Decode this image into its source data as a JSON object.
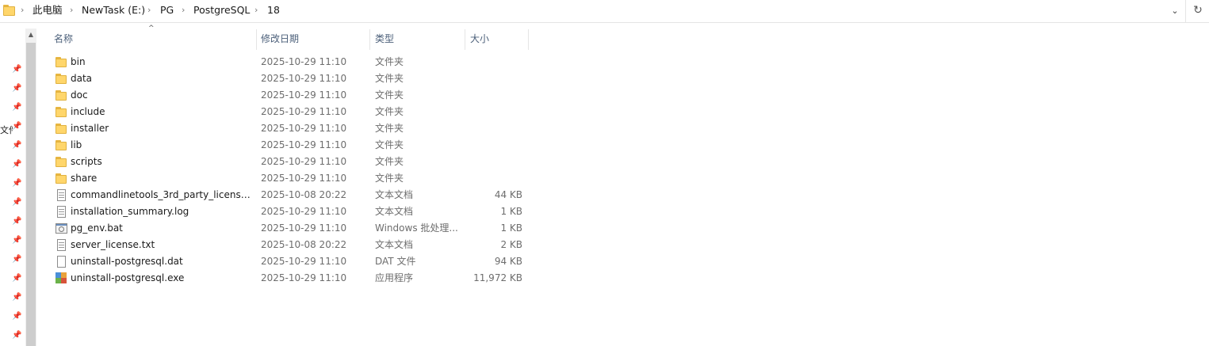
{
  "address_bar": {
    "crumbs": [
      "此电脑",
      "NewTask (E:)",
      "PG",
      "PostgreSQL",
      "18"
    ]
  },
  "nav_pane": {
    "label": "文件"
  },
  "columns": {
    "name": "名称",
    "date": "修改日期",
    "type": "类型",
    "size": "大小"
  },
  "files": [
    {
      "name": "bin",
      "date": "2025-10-29 11:10",
      "type": "文件夹",
      "size": "",
      "icon": "folder-icon"
    },
    {
      "name": "data",
      "date": "2025-10-29 11:10",
      "type": "文件夹",
      "size": "",
      "icon": "folder-icon"
    },
    {
      "name": "doc",
      "date": "2025-10-29 11:10",
      "type": "文件夹",
      "size": "",
      "icon": "folder-icon"
    },
    {
      "name": "include",
      "date": "2025-10-29 11:10",
      "type": "文件夹",
      "size": "",
      "icon": "folder-icon"
    },
    {
      "name": "installer",
      "date": "2025-10-29 11:10",
      "type": "文件夹",
      "size": "",
      "icon": "folder-icon"
    },
    {
      "name": "lib",
      "date": "2025-10-29 11:10",
      "type": "文件夹",
      "size": "",
      "icon": "folder-icon"
    },
    {
      "name": "scripts",
      "date": "2025-10-29 11:10",
      "type": "文件夹",
      "size": "",
      "icon": "folder-icon"
    },
    {
      "name": "share",
      "date": "2025-10-29 11:10",
      "type": "文件夹",
      "size": "",
      "icon": "folder-icon"
    },
    {
      "name": "commandlinetools_3rd_party_licenses...",
      "date": "2025-10-08 20:22",
      "type": "文本文档",
      "size": "44 KB",
      "icon": "text-document-icon"
    },
    {
      "name": "installation_summary.log",
      "date": "2025-10-29 11:10",
      "type": "文本文档",
      "size": "1 KB",
      "icon": "text-document-icon"
    },
    {
      "name": "pg_env.bat",
      "date": "2025-10-29 11:10",
      "type": "Windows 批处理...",
      "size": "1 KB",
      "icon": "batch-file-icon"
    },
    {
      "name": "server_license.txt",
      "date": "2025-10-08 20:22",
      "type": "文本文档",
      "size": "2 KB",
      "icon": "text-document-icon"
    },
    {
      "name": "uninstall-postgresql.dat",
      "date": "2025-10-29 11:10",
      "type": "DAT 文件",
      "size": "94 KB",
      "icon": "blank-file-icon"
    },
    {
      "name": "uninstall-postgresql.exe",
      "date": "2025-10-29 11:10",
      "type": "应用程序",
      "size": "11,972 KB",
      "icon": "application-icon"
    }
  ]
}
